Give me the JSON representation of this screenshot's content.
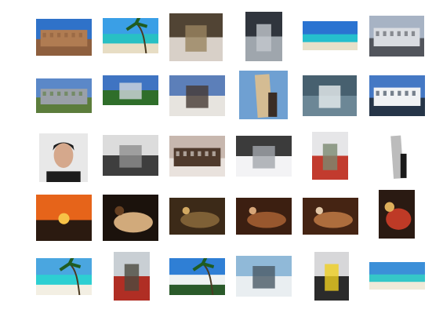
{
  "thumbnails": [
    {
      "row": 0,
      "col": 0,
      "scene": "colosseum",
      "colors": [
        "#2f72c9",
        "#b07c52",
        "#8e5f3e"
      ]
    },
    {
      "row": 0,
      "col": 1,
      "scene": "beach-palm",
      "colors": [
        "#3a9fe6",
        "#28c0c4",
        "#e7ddc4"
      ]
    },
    {
      "row": 0,
      "col": 2,
      "scene": "baby-stroller",
      "colors": [
        "#514434",
        "#d8d0c8",
        "#9a8460"
      ]
    },
    {
      "row": 0,
      "col": 3,
      "scene": "fence-closeup",
      "colors": [
        "#30353d",
        "#9fa6ad",
        "#c3c8cd"
      ]
    },
    {
      "row": 0,
      "col": 4,
      "scene": "beach-shore",
      "colors": [
        "#2a73d1",
        "#25bfcd",
        "#e8e0c9"
      ]
    },
    {
      "row": 0,
      "col": 5,
      "scene": "harbor-car",
      "colors": [
        "#a7b3c4",
        "#d9dce1",
        "#52555c"
      ]
    },
    {
      "row": 1,
      "col": 0,
      "scene": "stadium",
      "colors": [
        "#5b88c8",
        "#9aa0a8",
        "#5c7d3c"
      ]
    },
    {
      "row": 1,
      "col": 1,
      "scene": "park-field",
      "colors": [
        "#3f74c2",
        "#2f6e2a",
        "#d2d7de"
      ]
    },
    {
      "row": 1,
      "col": 2,
      "scene": "man-photographing",
      "colors": [
        "#5c7fb9",
        "#e7e4df",
        "#463a33"
      ]
    },
    {
      "row": 1,
      "col": 3,
      "scene": "pisa-pose",
      "colors": [
        "#6fa0d2",
        "#d4bc93",
        "#3a2d26"
      ]
    },
    {
      "row": 1,
      "col": 4,
      "scene": "swan-water",
      "colors": [
        "#47606f",
        "#6c8796",
        "#e9eeef"
      ]
    },
    {
      "row": 1,
      "col": 5,
      "scene": "ship-terminal",
      "colors": [
        "#4478c4",
        "#f0f2f4",
        "#263548"
      ]
    },
    {
      "row": 2,
      "col": 0,
      "scene": "portrait",
      "colors": [
        "#e8e8e8",
        "#1c1c1c",
        "#d5a88c"
      ]
    },
    {
      "row": 2,
      "col": 1,
      "scene": "bw-reclining",
      "colors": [
        "#dcdcdc",
        "#3e3e3e",
        "#8e8e8e"
      ]
    },
    {
      "row": 2,
      "col": 2,
      "scene": "ship-deck",
      "colors": [
        "#c7b7ae",
        "#4f3a2c",
        "#e9e2dd"
      ]
    },
    {
      "row": 2,
      "col": 3,
      "scene": "skier",
      "colors": [
        "#3b3b3b",
        "#f3f3f5",
        "#a3a6ad"
      ]
    },
    {
      "row": 2,
      "col": 4,
      "scene": "tram",
      "colors": [
        "#e6e6e8",
        "#c23b2e",
        "#7b8a70"
      ]
    },
    {
      "row": 2,
      "col": 5,
      "scene": "pisa-tower",
      "colors": [
        "#ffffff",
        "#bcbcbc",
        "#1a1a1a"
      ]
    },
    {
      "row": 3,
      "col": 0,
      "scene": "sunset-sea",
      "colors": [
        "#e6641a",
        "#2b1a10",
        "#f7c247"
      ]
    },
    {
      "row": 3,
      "col": 1,
      "scene": "car-night",
      "colors": [
        "#1b120c",
        "#f1c58f",
        "#6e4524"
      ]
    },
    {
      "row": 3,
      "col": 2,
      "scene": "christmas-room",
      "colors": [
        "#3c2a18",
        "#8a6a3c",
        "#e1b66a"
      ]
    },
    {
      "row": 3,
      "col": 3,
      "scene": "restaurant",
      "colors": [
        "#3c1f11",
        "#a86234",
        "#e7b484"
      ]
    },
    {
      "row": 3,
      "col": 4,
      "scene": "cafe-people",
      "colors": [
        "#452413",
        "#c07a45",
        "#f3d9b8"
      ]
    },
    {
      "row": 3,
      "col": 5,
      "scene": "guitar-red",
      "colors": [
        "#2a1a12",
        "#d8412a",
        "#f1c064"
      ]
    },
    {
      "row": 4,
      "col": 0,
      "scene": "beach-palm-2",
      "colors": [
        "#4aa6e0",
        "#2dcfd2",
        "#f3efe3"
      ]
    },
    {
      "row": 4,
      "col": 1,
      "scene": "tram-street",
      "colors": [
        "#c9cfd4",
        "#b02e24",
        "#4c4a3f"
      ]
    },
    {
      "row": 4,
      "col": 2,
      "scene": "beach-palm-3",
      "colors": [
        "#2f7fd5",
        "#eef2f2",
        "#2a5a2a"
      ]
    },
    {
      "row": 4,
      "col": 3,
      "scene": "bike-rack",
      "colors": [
        "#90b9d8",
        "#e9eef1",
        "#4a5a66"
      ]
    },
    {
      "row": 4,
      "col": 4,
      "scene": "cyclists",
      "colors": [
        "#d7d7d9",
        "#2b2b2b",
        "#f0d020"
      ]
    },
    {
      "row": 4,
      "col": 5,
      "scene": "beach-lagoon",
      "colors": [
        "#3b8fd8",
        "#35c7c8",
        "#f0ead9"
      ]
    }
  ]
}
